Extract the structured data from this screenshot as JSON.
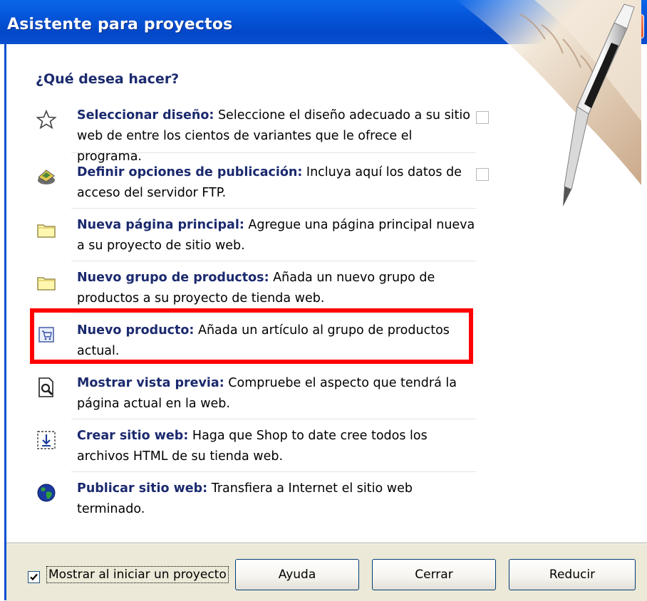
{
  "window": {
    "title": "Asistente para proyectos"
  },
  "heading": "¿Qué desea hacer?",
  "items": [
    {
      "icon": "star-icon",
      "title": "Seleccionar diseño:",
      "desc": " Seleccione el diseño adecuado a su sitio web de entre los cientos de variantes que le ofrece el programa.",
      "has_checkbox": true
    },
    {
      "icon": "publish-options-icon",
      "title": "Definir opciones de publicación:",
      "desc": " Incluya aquí los datos de acceso del servidor FTP.",
      "has_checkbox": true
    },
    {
      "icon": "folder-icon",
      "title": "Nueva página principal:",
      "desc": " Agregue una página principal nueva a su proyecto de sitio web.",
      "has_checkbox": false
    },
    {
      "icon": "folder-icon",
      "title": "Nuevo grupo de productos:",
      "desc": " Añada un nuevo grupo de productos a su proyecto de tienda web.",
      "has_checkbox": false
    },
    {
      "icon": "cart-product-icon",
      "title": "Nuevo producto:",
      "desc": " Añada un artículo al grupo de productos actual.",
      "has_checkbox": false
    },
    {
      "icon": "preview-magnifier-icon",
      "title": "Mostrar vista previa:",
      "desc": " Compruebe el aspecto que tendrá la página actual en la web.",
      "has_checkbox": false
    },
    {
      "icon": "build-site-icon",
      "title": "Crear sitio web:",
      "desc": " Haga que Shop to date cree todos los archivos HTML de su tienda web.",
      "has_checkbox": false
    },
    {
      "icon": "globe-icon",
      "title": "Publicar sitio web:",
      "desc": " Transfiera a Internet el sitio web terminado.",
      "has_checkbox": false
    }
  ],
  "footer": {
    "show_on_start_label": "Mostrar al iniciar un proyecto",
    "show_on_start_checked": true,
    "help_label": "Ayuda",
    "close_label": "Cerrar",
    "minimize_label": "Reducir"
  },
  "colors": {
    "titlebar": "#0554d8",
    "heading": "#1b2a6e",
    "highlight": "#ff0000",
    "footer_bg": "#ece9d8"
  }
}
